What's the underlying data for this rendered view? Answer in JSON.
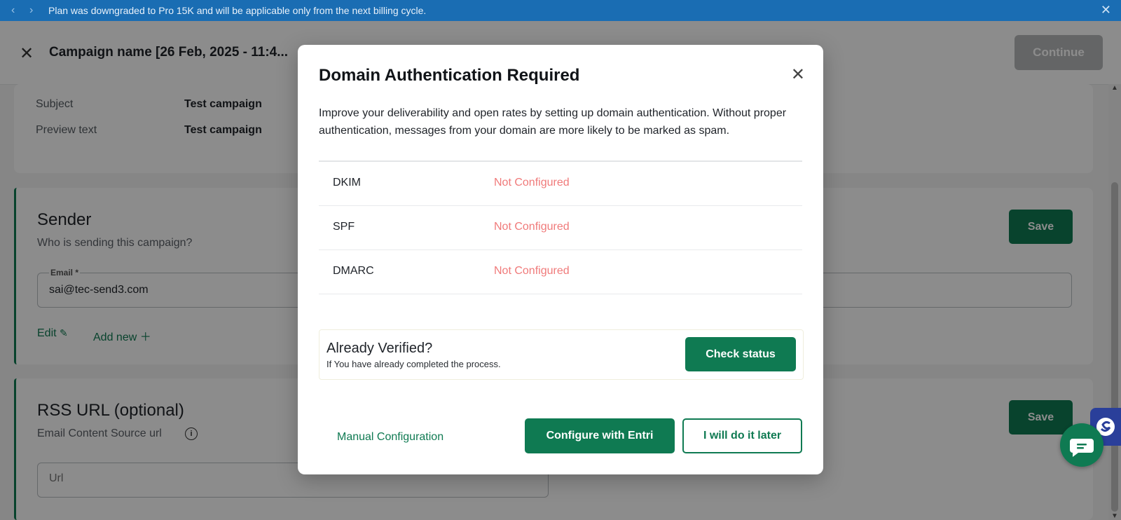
{
  "notification": {
    "message": "Plan was downgraded to Pro 15K and will be applicable only from the next billing cycle.",
    "prev_icon": "chevron-left-icon",
    "next_icon": "chevron-right-icon",
    "close_icon": "close-icon"
  },
  "header": {
    "title": "Campaign name [26 Feb, 2025 - 11:4...",
    "continue_label": "Continue"
  },
  "details": {
    "subject_label": "Subject",
    "subject_value": "Test campaign",
    "preview_label": "Preview text",
    "preview_value": "Test campaign"
  },
  "sender": {
    "heading": "Sender",
    "subheading": "Who is sending this campaign?",
    "email_label": "Email *",
    "email_value": "sai@tec-send3.com",
    "edit_label": "Edit",
    "add_new_label": "Add new",
    "save_label": "Save"
  },
  "rss": {
    "heading": "RSS URL (optional)",
    "subheading": "Email Content Source url",
    "url_placeholder": "Url",
    "save_label": "Save"
  },
  "modal": {
    "title": "Domain Authentication Required",
    "description": "Improve your deliverability and open rates by setting up domain authentication. Without proper authentication, messages from your domain are more likely to be marked as spam.",
    "records": [
      {
        "name": "DKIM",
        "status": "Not Configured"
      },
      {
        "name": "SPF",
        "status": "Not Configured"
      },
      {
        "name": "DMARC",
        "status": "Not Configured"
      }
    ],
    "verified_title": "Already Verified?",
    "verified_subtitle": "If You have already completed the process.",
    "check_status_label": "Check status",
    "manual_label": "Manual Configuration",
    "entri_label": "Configure with Entri",
    "later_label": "I will do it later"
  },
  "colors": {
    "brand": "#0f7a52",
    "notification_bg": "#1a6db3",
    "status_error": "#f07a7a"
  }
}
